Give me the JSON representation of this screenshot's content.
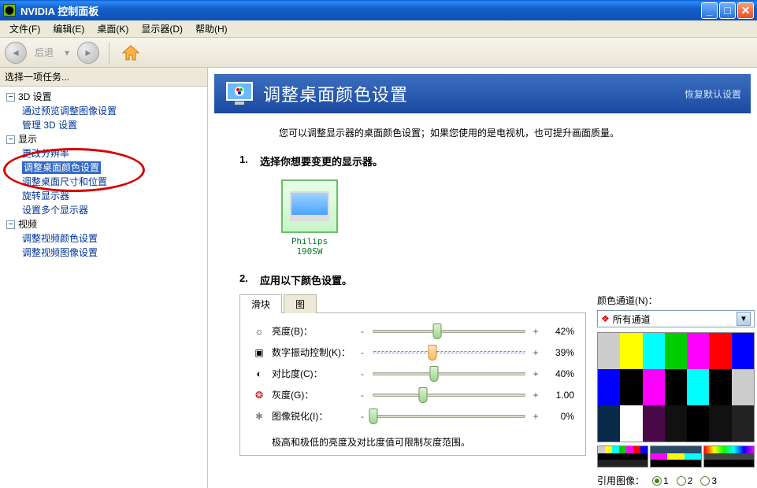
{
  "window": {
    "title": "NVIDIA 控制面板"
  },
  "menu": {
    "file": "文件(F)",
    "edit": "编辑(E)",
    "desktop": "桌面(K)",
    "display": "显示器(D)",
    "help": "帮助(H)"
  },
  "toolbar": {
    "back_label": "后退"
  },
  "sidebar": {
    "header": "选择一项任务...",
    "groups": [
      {
        "label": "3D 设置",
        "items": [
          "通过预览调整图像设置",
          "管理 3D 设置"
        ]
      },
      {
        "label": "显示",
        "items": [
          "更改分辨率",
          "调整桌面颜色设置",
          "调整桌面尺寸和位置",
          "旋转显示器",
          "设置多个显示器"
        ],
        "selected_index": 1
      },
      {
        "label": "视频",
        "items": [
          "调整视频颜色设置",
          "调整视频图像设置"
        ]
      }
    ]
  },
  "banner": {
    "title": "调整桌面颜色设置",
    "restore": "恢复默认设置"
  },
  "description": "您可以调整显示器的桌面颜色设置；如果您使用的是电视机，也可提升画面质量。",
  "section1": {
    "num": "1.",
    "title": "选择你想要变更的显示器。"
  },
  "monitor": {
    "name": "Philips 190SW"
  },
  "section2": {
    "num": "2.",
    "title": "应用以下颜色设置。"
  },
  "tabs": {
    "slider": "滑块",
    "image": "图"
  },
  "sliders": {
    "brightness": {
      "icon": "☼",
      "label": "亮度(B)：",
      "minus": "-",
      "plus": "+",
      "value": "42%",
      "pos": 42
    },
    "vibrance": {
      "icon": "▣",
      "label": "数字振动控制(K)：",
      "minus": "-",
      "plus": "+",
      "value": "39%",
      "pos": 39,
      "highlight": true
    },
    "contrast": {
      "icon": "◐",
      "label": "对比度(C)：",
      "minus": "-",
      "plus": "+",
      "value": "40%",
      "pos": 40
    },
    "gamma": {
      "icon": "❂",
      "label": "灰度(G)：",
      "minus": "-",
      "plus": "+",
      "value": "1.00",
      "pos": 33
    },
    "sharpen": {
      "icon": "✱",
      "label": "图像锐化(I)：",
      "minus": "-",
      "plus": "+",
      "value": "0%",
      "pos": 0
    },
    "note": "极高和极低的亮度及对比度值可限制灰度范围。"
  },
  "channel": {
    "label": "颜色通道(N)：",
    "icon": "❖",
    "selected": "所有通道"
  },
  "reference": {
    "label": "引用图像：",
    "options": [
      "1",
      "2",
      "3"
    ],
    "selected_index": 0
  }
}
